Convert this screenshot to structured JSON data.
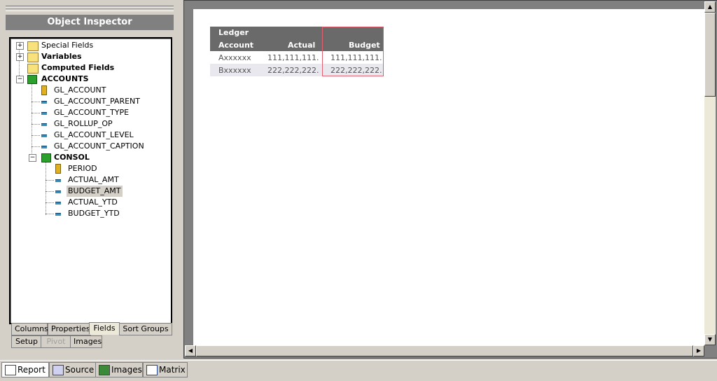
{
  "panel": {
    "title": "Object Inspector",
    "tree": [
      {
        "label": "Special Fields",
        "bold": true,
        "level": 0,
        "expander": "+",
        "icon": "folder"
      },
      {
        "label": "Variables",
        "bold": true,
        "level": 0,
        "expander": "+",
        "icon": "folder"
      },
      {
        "label": "Computed Fields",
        "bold": true,
        "level": 0,
        "expander": "",
        "icon": "folder"
      },
      {
        "label": "ACCOUNTS",
        "bold": true,
        "level": 0,
        "expander": "-",
        "icon": "table"
      },
      {
        "label": "GL_ACCOUNT",
        "bold": false,
        "level": 1,
        "expander": "",
        "icon": "key"
      },
      {
        "label": "GL_ACCOUNT_PARENT",
        "bold": false,
        "level": 1,
        "expander": "",
        "icon": "field"
      },
      {
        "label": "GL_ACCOUNT_TYPE",
        "bold": false,
        "level": 1,
        "expander": "",
        "icon": "field"
      },
      {
        "label": "GL_ROLLUP_OP",
        "bold": false,
        "level": 1,
        "expander": "",
        "icon": "field"
      },
      {
        "label": "GL_ACCOUNT_LEVEL",
        "bold": false,
        "level": 1,
        "expander": "",
        "icon": "field"
      },
      {
        "label": "GL_ACCOUNT_CAPTION",
        "bold": false,
        "level": 1,
        "expander": "",
        "icon": "field"
      },
      {
        "label": "CONSOL",
        "bold": true,
        "level": 1,
        "expander": "-",
        "icon": "table"
      },
      {
        "label": "PERIOD",
        "bold": false,
        "level": 2,
        "expander": "",
        "icon": "key"
      },
      {
        "label": "ACTUAL_AMT",
        "bold": false,
        "level": 2,
        "expander": "",
        "icon": "field"
      },
      {
        "label": "BUDGET_AMT",
        "bold": false,
        "level": 2,
        "expander": "",
        "icon": "field",
        "selected": true
      },
      {
        "label": "ACTUAL_YTD",
        "bold": false,
        "level": 2,
        "expander": "",
        "icon": "field"
      },
      {
        "label": "BUDGET_YTD",
        "bold": false,
        "level": 2,
        "expander": "",
        "icon": "field"
      }
    ],
    "tabs_row1": [
      "Columns",
      "Properties",
      "Fields",
      "Sort Groups"
    ],
    "tabs_row2": [
      "Setup",
      "Pivot",
      "Images"
    ],
    "active_tab": "Fields",
    "disabled_tab": "Pivot"
  },
  "report": {
    "header_line1": "Ledger",
    "col_account": "Account",
    "col_actual": "Actual",
    "col_budget": "Budget",
    "rows": [
      {
        "account": "Axxxxxx",
        "actual": "111,111,111.",
        "budget": "111,111,111."
      },
      {
        "account": "Bxxxxxx",
        "actual": "222,222,222.",
        "budget": "222,222,222."
      }
    ]
  },
  "bottom_tabs": [
    "Report",
    "Source",
    "Images",
    "Matrix"
  ],
  "active_bottom_tab": "Report",
  "icons": {
    "expand_collapse": "plus-minus-box",
    "folder": "folder-icon",
    "table": "green-cube-icon",
    "key": "key-icon",
    "field": "field-icon"
  }
}
